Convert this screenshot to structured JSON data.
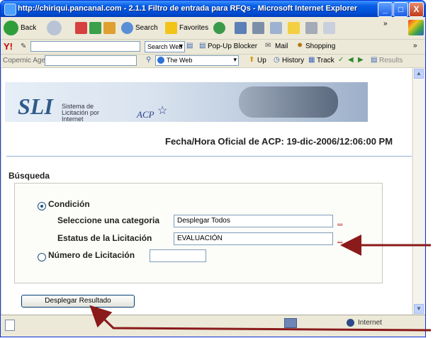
{
  "window": {
    "title": "http://chiriqui.pancanal.com - 2.1.1 Filtro de entrada para RFQs - Microsoft Internet Explorer",
    "minimize_glyph": "_",
    "maximize_glyph": "□",
    "close_glyph": "X"
  },
  "toolbar": {
    "back_label": "Back",
    "search_label": "Search",
    "favorites_label": "Favorites",
    "chevron": "»"
  },
  "yahoo_bar": {
    "logo": "Y!",
    "search_button": "Search Web",
    "popup_blocker": "Pop-Up Blocker",
    "mail": "Mail",
    "shopping": "Shopping",
    "chevron": "»"
  },
  "copernic_bar": {
    "label": "Copernic Agent",
    "the_web": "The Web",
    "up": "Up",
    "history": "History",
    "track": "Track",
    "results": "Results"
  },
  "page": {
    "sli_logo": "SLI",
    "sli_subtitle": "Sistema de Licitación por Internet",
    "acp_logo": "ACP",
    "fecha": "Fecha/Hora Oficial de ACP: 19-dic-2006/12:06:00 PM",
    "busqueda": "Búsqueda",
    "condicion": "Condición",
    "categoria_label": "Seleccione una categoria",
    "categoria_value": "Desplegar Todos",
    "estatus_label": "Estatus de la Licitación",
    "estatus_value": "EVALUACIÓN",
    "dots": "...",
    "numero_label": "Número de Licitación",
    "numero_value": "",
    "button": "Desplegar Resultado"
  },
  "statusbar": {
    "zone": "Internet"
  },
  "colors": {
    "arrow": "#8b1a1a",
    "titlebar": "#0a5fe6"
  }
}
